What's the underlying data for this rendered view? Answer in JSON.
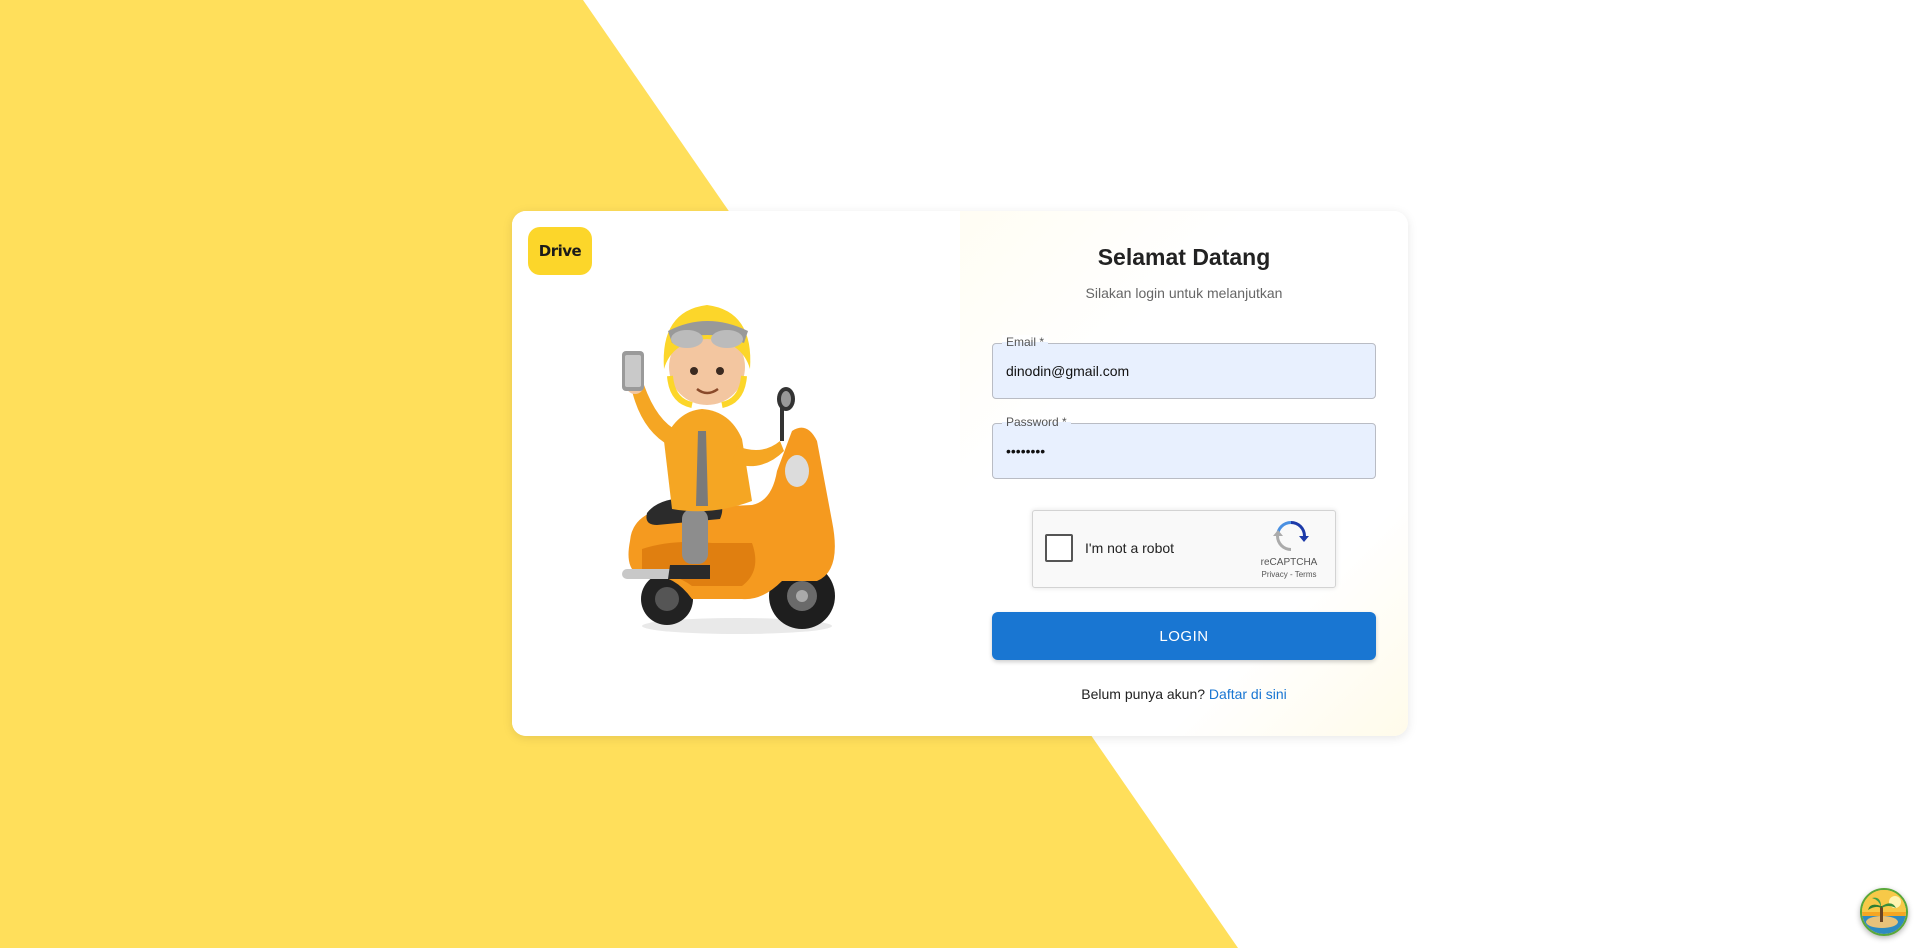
{
  "brand": {
    "logo_text": "Drive",
    "accent_color": "#FCD62A",
    "primary_color": "#1976D2"
  },
  "login": {
    "title": "Selamat Datang",
    "subtitle": "Silakan login untuk melanjutkan",
    "email": {
      "label": "Email *",
      "value": "dinodin@gmail.com"
    },
    "password": {
      "label": "Password *",
      "value": "••••••••"
    },
    "recaptcha": {
      "label": "I'm not a robot",
      "brand": "reCAPTCHA",
      "links": "Privacy - Terms"
    },
    "submit_label": "LOGIN",
    "register_prompt": "Belum punya akun?",
    "register_link": "Daftar di sini"
  },
  "icons": {
    "illustration": "scooter-rider-illustration",
    "floating_button": "tropical-island-avatar-icon"
  }
}
